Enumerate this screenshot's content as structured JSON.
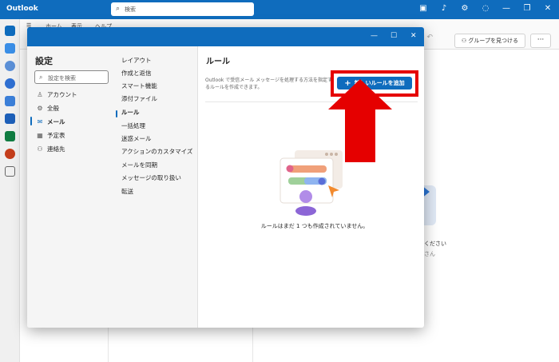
{
  "app": {
    "title": "Outlook"
  },
  "search": {
    "placeholder": "検索"
  },
  "ribbon": {
    "tabs": [
      "ホーム",
      "表示",
      "ヘルプ"
    ],
    "find_groups": "グループを見つける",
    "more": "···"
  },
  "background": {
    "hint_line1": "ください",
    "hint_line2": "さん"
  },
  "settings": {
    "title": "設定",
    "search_placeholder": "設定を検索",
    "categories": [
      {
        "label": "アカウント",
        "icon": "person-icon"
      },
      {
        "label": "全般",
        "icon": "gear-icon"
      },
      {
        "label": "メール",
        "icon": "mail-icon",
        "active": true
      },
      {
        "label": "予定表",
        "icon": "calendar-icon"
      },
      {
        "label": "連絡先",
        "icon": "contacts-icon"
      }
    ],
    "mail_items": [
      "レイアウト",
      "作成と返信",
      "スマート機能",
      "添付ファイル",
      "ルール",
      "一括処理",
      "迷惑メール",
      "アクションのカスタマイズ",
      "メールを同期",
      "メッセージの取り扱い",
      "転送"
    ],
    "active_mail_item": "ルール"
  },
  "rules": {
    "title": "ルール",
    "description": "Outlook で受信メール メッセージを処理する方法を指定するルールを作成できます。",
    "add_button": "新しいルールを追加",
    "empty_message": "ルールはまだ 1 つも作成されていません。"
  },
  "colors": {
    "brand": "#0f6cbd",
    "highlight": "#e50000"
  }
}
